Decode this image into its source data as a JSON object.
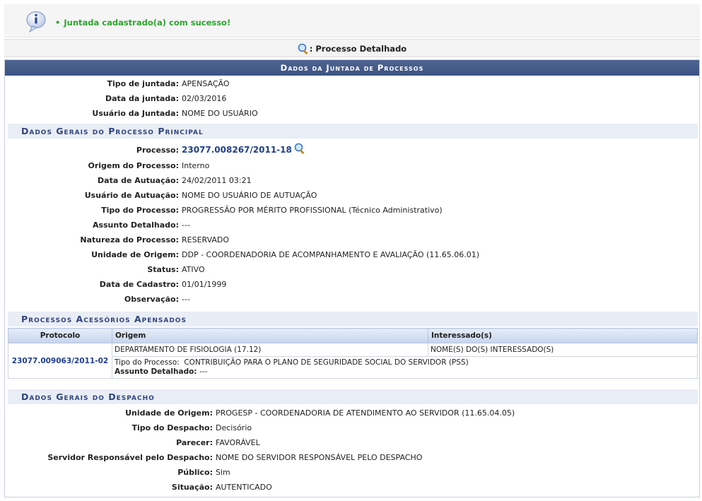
{
  "message": {
    "bullet": "•",
    "text": "Juntada cadastrado(a) com sucesso!"
  },
  "detail_link": {
    "label": ": Processo Detalhado"
  },
  "main": {
    "caption": "Dados da Juntada de Processos",
    "juntada": [
      {
        "label": "Tipo de juntada:",
        "value": "APENSAÇÃO"
      },
      {
        "label": "Data da juntada:",
        "value": "02/03/2016"
      },
      {
        "label": "Usuário da Juntada:",
        "value": "NOME DO USUÁRIO"
      }
    ]
  },
  "principal": {
    "title": "Dados Gerais do Processo Principal",
    "processo_label": "Processo:",
    "processo_value": "23077.008267/2011-18",
    "rows": [
      {
        "label": "Origem do Processo:",
        "value": "Interno"
      },
      {
        "label": "Data de Autuação:",
        "value": "24/02/2011 03:21"
      },
      {
        "label": "Usuário de Autuação:",
        "value": "NOME DO USUÁRIO DE AUTUAÇÃO"
      },
      {
        "label": "Tipo do Processo:",
        "value": "PROGRESSÃO POR MÉRITO PROFISSIONAL (Técnico Administrativo)"
      },
      {
        "label": "Assunto Detalhado:",
        "value": "---"
      },
      {
        "label": "Natureza do Processo:",
        "value": "RESERVADO"
      },
      {
        "label": "Unidade de Origem:",
        "value": "DDP - COORDENADORIA DE ACOMPANHAMENTO E AVALIAÇÃO (11.65.06.01)"
      },
      {
        "label": "Status:",
        "value": "ATIVO"
      },
      {
        "label": "Data de Cadastro:",
        "value": "01/01/1999"
      },
      {
        "label": "Observação:",
        "value": "---"
      }
    ]
  },
  "acessorios": {
    "title": "Processos Acessórios Apensados",
    "headers": [
      "Protocolo",
      "Origem",
      "Interessado(s)"
    ],
    "rows": [
      {
        "protocolo": "23077.009063/2011-02",
        "origem": "DEPARTAMENTO DE FISIOLOGIA (17.12)",
        "interessados": "NOME(S) DO(S) INTERESSADO(S)",
        "tipo_label": "Tipo do Processo:",
        "tipo_value": "CONTRIBUIÇÃO PARA O PLANO DE SEGURIDADE SOCIAL DO SERVIDOR (PSS)",
        "assunto_label": "Assunto Detalhado:",
        "assunto_value": "---"
      }
    ]
  },
  "despacho": {
    "title": "Dados Gerais do Despacho",
    "rows": [
      {
        "label": "Unidade de Origem:",
        "value": "PROGESP - COORDENADORIA DE ATENDIMENTO AO SERVIDOR (11.65.04.05)"
      },
      {
        "label": "Tipo do Despacho:",
        "value": "Decisório"
      },
      {
        "label": "Parecer:",
        "value": "FAVORÁVEL"
      },
      {
        "label": "Servidor Responsável pelo Despacho:",
        "value": "NOME DO SERVIDOR RESPONSÁVEL PELO DESPACHO"
      },
      {
        "label": "Público:",
        "value": "Sim"
      },
      {
        "label": "Situação:",
        "value": "AUTENTICADO"
      }
    ]
  }
}
